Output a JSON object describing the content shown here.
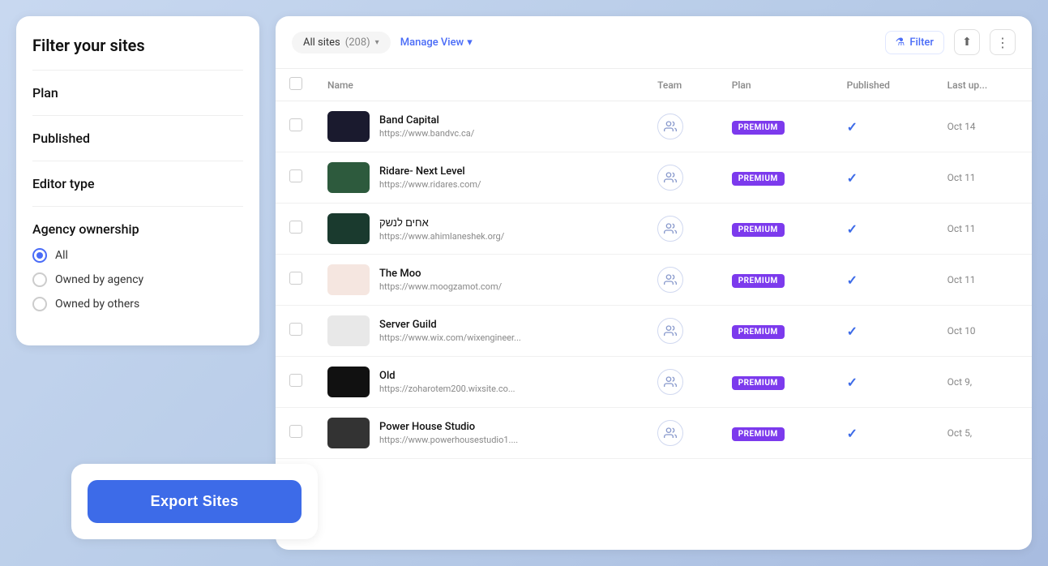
{
  "leftPanel": {
    "title": "Filter your sites",
    "sections": [
      {
        "id": "plan",
        "label": "Plan"
      },
      {
        "id": "published",
        "label": "Published"
      },
      {
        "id": "editor-type",
        "label": "Editor type"
      }
    ],
    "agencyOwnership": {
      "title": "Agency ownership",
      "options": [
        {
          "id": "all",
          "label": "All",
          "checked": true
        },
        {
          "id": "owned-by-agency",
          "label": "Owned by agency",
          "checked": false
        },
        {
          "id": "owned-by-others",
          "label": "Owned by others",
          "checked": false
        }
      ]
    },
    "exportButton": "Export Sites"
  },
  "rightPanel": {
    "allSites": "All sites",
    "count": "(208)",
    "manageView": "Manage View",
    "filter": "Filter",
    "columns": {
      "name": "Name",
      "team": "Team",
      "plan": "Plan",
      "published": "Published",
      "lastUpdated": "Last up..."
    },
    "rows": [
      {
        "id": 1,
        "name": "Band Capital",
        "url": "https://www.bandvc.ca/",
        "plan": "PREMIUM",
        "published": true,
        "lastUpdated": "Oct 14",
        "thumbClass": "thumb-band"
      },
      {
        "id": 2,
        "name": "Ridare- Next Level",
        "url": "https://www.ridares.com/",
        "plan": "PREMIUM",
        "published": true,
        "lastUpdated": "Oct 11",
        "thumbClass": "thumb-ridare"
      },
      {
        "id": 3,
        "name": "אחים לנשק",
        "url": "https://www.ahimlaneshek.org/",
        "plan": "PREMIUM",
        "published": true,
        "lastUpdated": "Oct 11",
        "thumbClass": "thumb-ahim"
      },
      {
        "id": 4,
        "name": "The Moo",
        "url": "https://www.moogzamot.com/",
        "plan": "PREMIUM",
        "published": true,
        "lastUpdated": "Oct 11",
        "thumbClass": "thumb-moo"
      },
      {
        "id": 5,
        "name": "Server Guild",
        "url": "https://www.wix.com/wixengineer...",
        "plan": "PREMIUM",
        "published": true,
        "lastUpdated": "Oct 10",
        "thumbClass": "thumb-server"
      },
      {
        "id": 6,
        "name": "Old",
        "url": "https://zoharotem200.wixsite.co...",
        "plan": "PREMIUM",
        "published": true,
        "lastUpdated": "Oct 9,",
        "thumbClass": "thumb-old"
      },
      {
        "id": 7,
        "name": "Power House Studio",
        "url": "https://www.powerhousestudio1....",
        "plan": "PREMIUM",
        "published": true,
        "lastUpdated": "Oct 5,",
        "thumbClass": "thumb-power"
      }
    ]
  }
}
